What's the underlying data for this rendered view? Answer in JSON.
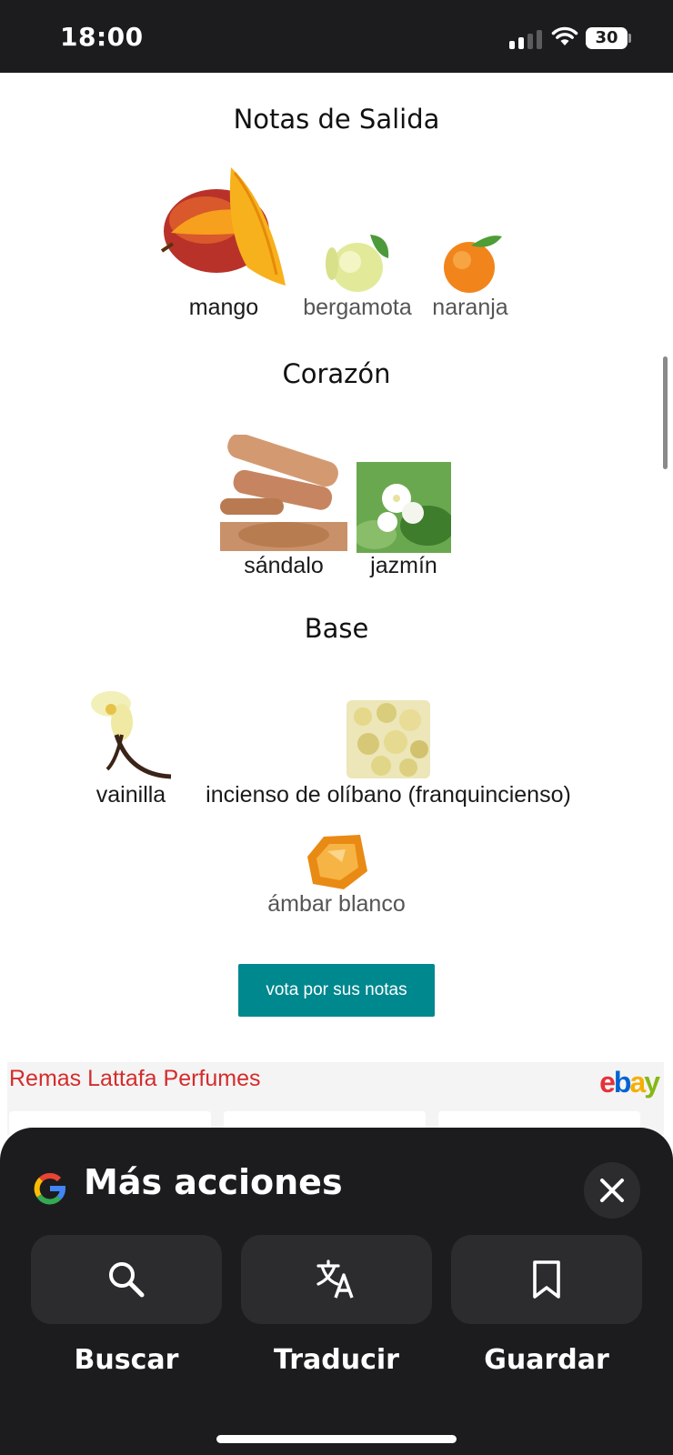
{
  "status_bar": {
    "time": "18:00",
    "battery": "30",
    "signal_bars_active": 2,
    "signal_bars_total": 4
  },
  "notes": {
    "top": {
      "title": "Notas de Salida",
      "items": [
        {
          "label": "mango",
          "icon": "mango-icon"
        },
        {
          "label": "bergamota",
          "icon": "bergamot-icon"
        },
        {
          "label": "naranja",
          "icon": "orange-icon"
        }
      ]
    },
    "heart": {
      "title": "Corazón",
      "items": [
        {
          "label": "sándalo",
          "icon": "sandalwood-icon"
        },
        {
          "label": "jazmín",
          "icon": "jasmine-icon"
        }
      ]
    },
    "base": {
      "title": "Base",
      "items": [
        {
          "label": "vainilla",
          "icon": "vanilla-icon"
        },
        {
          "label": "incienso de olíbano (franquincienso)",
          "icon": "frankincense-icon"
        },
        {
          "label": "ámbar blanco",
          "icon": "amber-icon"
        }
      ]
    }
  },
  "vote_button": "vota por sus notas",
  "ad": {
    "title": "Remas Lattafa Perfumes",
    "brand": {
      "e": "e",
      "b": "b",
      "a": "a",
      "y": "y"
    },
    "brand_colors": {
      "e": "#e53238",
      "b": "#0064d2",
      "a": "#f5af02",
      "y": "#86b817"
    }
  },
  "sheet": {
    "title": "Más acciones",
    "actions": [
      {
        "label": "Buscar",
        "icon": "search-icon"
      },
      {
        "label": "Traducir",
        "icon": "translate-icon"
      },
      {
        "label": "Guardar",
        "icon": "bookmark-icon"
      }
    ]
  },
  "colors": {
    "accent_button": "#00888f",
    "ad_title": "#d42c2c",
    "sheet_bg": "#1c1c1e"
  }
}
